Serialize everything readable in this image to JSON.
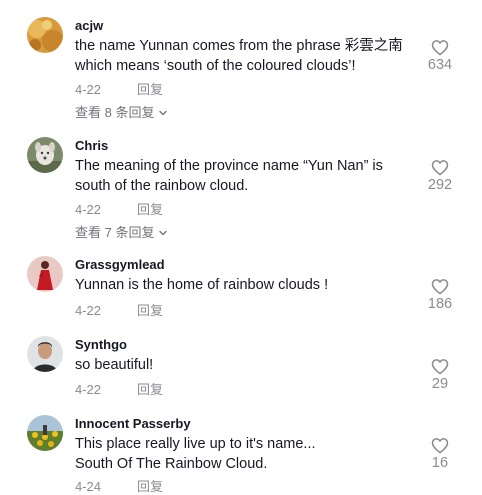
{
  "comments": [
    {
      "username": "acjw",
      "lines": [
        "the name Yunnan comes from the phrase 彩雲之南",
        "which means ‘south of the coloured clouds’!"
      ],
      "date": "4-22",
      "reply_label": "回复",
      "likes": "634",
      "view_replies": "查看 8 条回复",
      "avatar_icon": "avatar-autumn-leaves"
    },
    {
      "username": "Chris",
      "lines": [
        "The meaning of the province name “Yun Nan” is",
        "south of the rainbow cloud."
      ],
      "date": "4-22",
      "reply_label": "回复",
      "likes": "292",
      "view_replies": "查看 7 条回复",
      "avatar_icon": "avatar-dog"
    },
    {
      "username": "Grassgymlead",
      "lines": [
        "Yunnan is the home of rainbow clouds !"
      ],
      "date": "4-22",
      "reply_label": "回复",
      "likes": "186",
      "avatar_icon": "avatar-red-dress"
    },
    {
      "username": "Synthgo",
      "lines": [
        "so beautiful!"
      ],
      "date": "4-22",
      "reply_label": "回复",
      "likes": "29",
      "avatar_icon": "avatar-person"
    },
    {
      "username": "Innocent Passerby",
      "lines": [
        "This place really live up to it's name...",
        "South Of The Rainbow Cloud."
      ],
      "date": "4-24",
      "reply_label": "回复",
      "likes": "16",
      "avatar_icon": "avatar-sunflowers"
    }
  ],
  "icons": {
    "like": "heart-outline-icon",
    "expand": "chevron-down-icon"
  },
  "colors": {
    "text": "#161823",
    "muted": "#8a8b91",
    "icon": "#8a8b91"
  }
}
